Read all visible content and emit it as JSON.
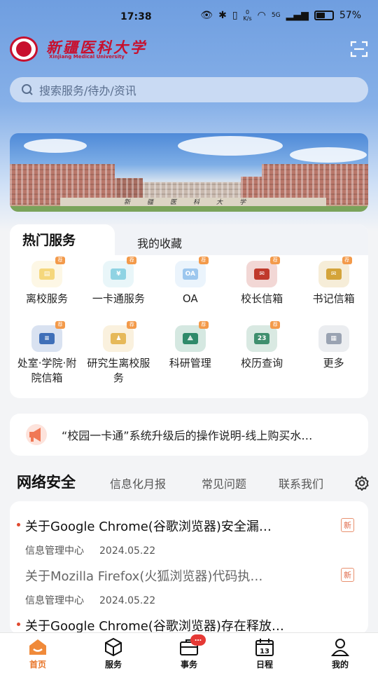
{
  "status_bar": {
    "time": "17:38",
    "speed_value": "0",
    "speed_unit": "K/s",
    "network": "5G",
    "battery": "57%",
    "battery_level": 0.57
  },
  "header": {
    "logo_cn": "新疆医科大学",
    "logo_en": "Xinjiang Medical University",
    "scan_icon": "scan-icon"
  },
  "search": {
    "placeholder": "搜索服务/待办/资讯"
  },
  "banner": {
    "gate_text": "新疆医科大学"
  },
  "services": {
    "tabs": [
      "热门服务",
      "我的收藏"
    ],
    "badge": "荐",
    "items": [
      {
        "label": "离校服务",
        "icon": "certificate-icon",
        "color": "#f5d77c"
      },
      {
        "label": "一卡通服务",
        "icon": "card-icon",
        "color": "#8fd3e3"
      },
      {
        "label": "OA",
        "icon": "oa-icon",
        "color": "#9dc7ee"
      },
      {
        "label": "校长信箱",
        "icon": "mailbox-icon",
        "color": "#c0392b"
      },
      {
        "label": "书记信箱",
        "icon": "mailbox-icon",
        "color": "#d4a43a"
      },
      {
        "label": "处室·学院·附院信箱",
        "icon": "chat-icon",
        "color": "#3f6fb8"
      },
      {
        "label": "研究生离校服务",
        "icon": "graduate-icon",
        "color": "#e6b95a"
      },
      {
        "label": "科研管理",
        "icon": "research-icon",
        "color": "#2f8a6a"
      },
      {
        "label": "校历查询",
        "icon": "calendar-icon",
        "color": "#3f8f6e"
      },
      {
        "label": "更多",
        "icon": "grid-icon",
        "color": "#9aa3b2"
      }
    ]
  },
  "notice": {
    "text": "“校园一卡通”系统升级后的操作说明-线上购买水…",
    "icon": "megaphone-icon"
  },
  "section_tabs": {
    "active": "网络安全",
    "others": [
      "信息化月报",
      "常见问题",
      "联系我们"
    ]
  },
  "news": [
    {
      "title": "关于Google Chrome(谷歌浏览器)安全漏…",
      "source": "信息管理中心",
      "date": "2024.05.22",
      "tag": "新",
      "unread": true
    },
    {
      "title": "关于Mozilla Firefox(火狐浏览器)代码执…",
      "source": "信息管理中心",
      "date": "2024.05.22",
      "tag": "新",
      "unread": false
    },
    {
      "title": "关于Google Chrome(谷歌浏览器)存在释放…",
      "source": "",
      "date": "",
      "tag": "",
      "unread": true
    }
  ],
  "bottom_nav": {
    "items": [
      {
        "label": "首页",
        "icon": "home-icon",
        "active": true
      },
      {
        "label": "服务",
        "icon": "cube-icon",
        "active": false
      },
      {
        "label": "事务",
        "icon": "briefcase-icon",
        "active": false,
        "badge": "…"
      },
      {
        "label": "日程",
        "icon": "calendar-icon",
        "active": false,
        "day": "13"
      },
      {
        "label": "我的",
        "icon": "user-icon",
        "active": false
      }
    ]
  },
  "colors": {
    "accent": "#e8762a",
    "brand_red": "#c8102e",
    "sky": "#6f9ee0"
  }
}
